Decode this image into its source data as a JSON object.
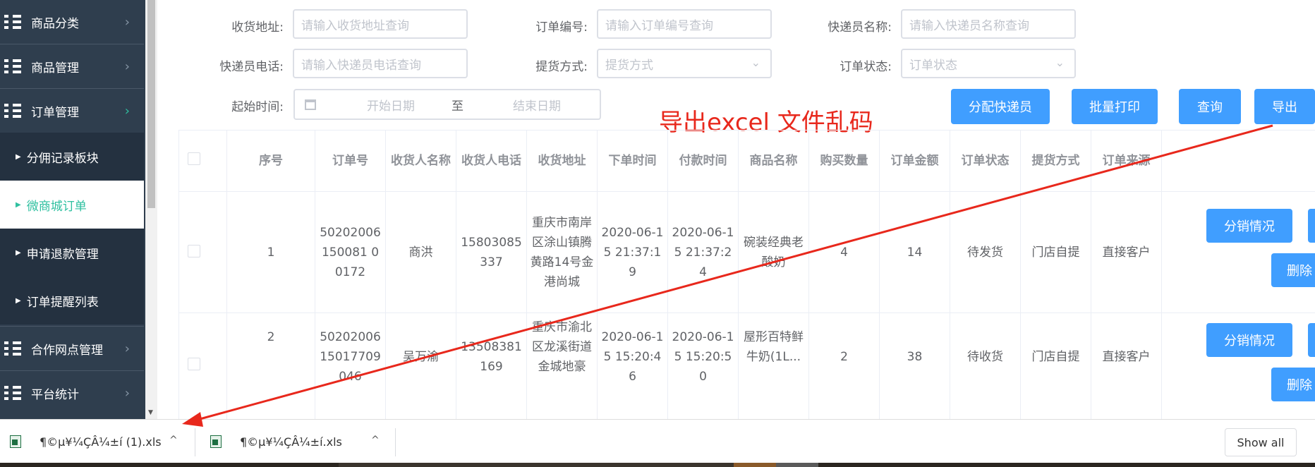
{
  "sidebar": {
    "items": [
      {
        "label": "商品分类",
        "type": "menu"
      },
      {
        "label": "商品管理",
        "type": "menu"
      },
      {
        "label": "订单管理",
        "type": "menu"
      },
      {
        "label": "分佣记录板块",
        "type": "sub"
      },
      {
        "label": "微商城订单",
        "type": "sub"
      },
      {
        "label": "申请退款管理",
        "type": "sub"
      },
      {
        "label": "订单提醒列表",
        "type": "sub"
      },
      {
        "label": "合作网点管理",
        "type": "menu"
      },
      {
        "label": "平台统计",
        "type": "menu"
      }
    ]
  },
  "filters": {
    "address_label": "收货地址:",
    "address_placeholder": "请输入收货地址查询",
    "order_no_label": "订单编号:",
    "order_no_placeholder": "请输入订单编号查询",
    "courier_name_label": "快递员名称:",
    "courier_name_placeholder": "请输入快递员名称查询",
    "courier_phone_label": "快递员电话:",
    "courier_phone_placeholder": "请输入快递员电话查询",
    "pickup_label": "提货方式:",
    "pickup_placeholder": "提货方式",
    "status_label": "订单状态:",
    "status_placeholder": "订单状态",
    "time_label": "起始时间:",
    "start_placeholder": "开始日期",
    "range_sep": "至",
    "end_placeholder": "结束日期"
  },
  "toolbar": {
    "assign": "分配快递员",
    "print": "批量打印",
    "query": "查询",
    "export": "导出"
  },
  "annotation": "导出excel 文件乱码",
  "table": {
    "headers": [
      "序号",
      "订单号",
      "收货人名称",
      "收货人电话",
      "收货地址",
      "下单时间",
      "付款时间",
      "商品名称",
      "购买数量",
      "订单金额",
      "订单状态",
      "提货方式",
      "订单来源"
    ],
    "rows": [
      {
        "cells": [
          "1",
          "50202006150081 00172",
          "商洪",
          "15803085337",
          "重庆市南岸区涂山镇腾黄路14号金港尚城",
          "2020-06-15 21:37:19",
          "2020-06-15 21:37:24",
          "碗装经典老酸奶",
          "4",
          "14",
          "待发货",
          "门店自提",
          "直接客户"
        ],
        "btn_dist": "分销情况",
        "btn_del": "删除"
      },
      {
        "cells": [
          "2",
          "5020200615017709046",
          "吴万渝",
          "13508381169",
          "重庆市渝北区龙溪街道金城地豪",
          "2020-06-15 15:20:46",
          "2020-06-15 15:20:50",
          "屋形百特鲜牛奶(1L...",
          "2",
          "38",
          "待收货",
          "门店自提",
          "直接客户"
        ],
        "btn_dist": "分销情况",
        "btn_del": "删除"
      }
    ]
  },
  "downloads": {
    "file1": "¶©µ¥¼ÇÂ¼±í (1).xls",
    "file2": "¶©µ¥¼ÇÂ¼±í.xls",
    "show_all": "Show all"
  }
}
